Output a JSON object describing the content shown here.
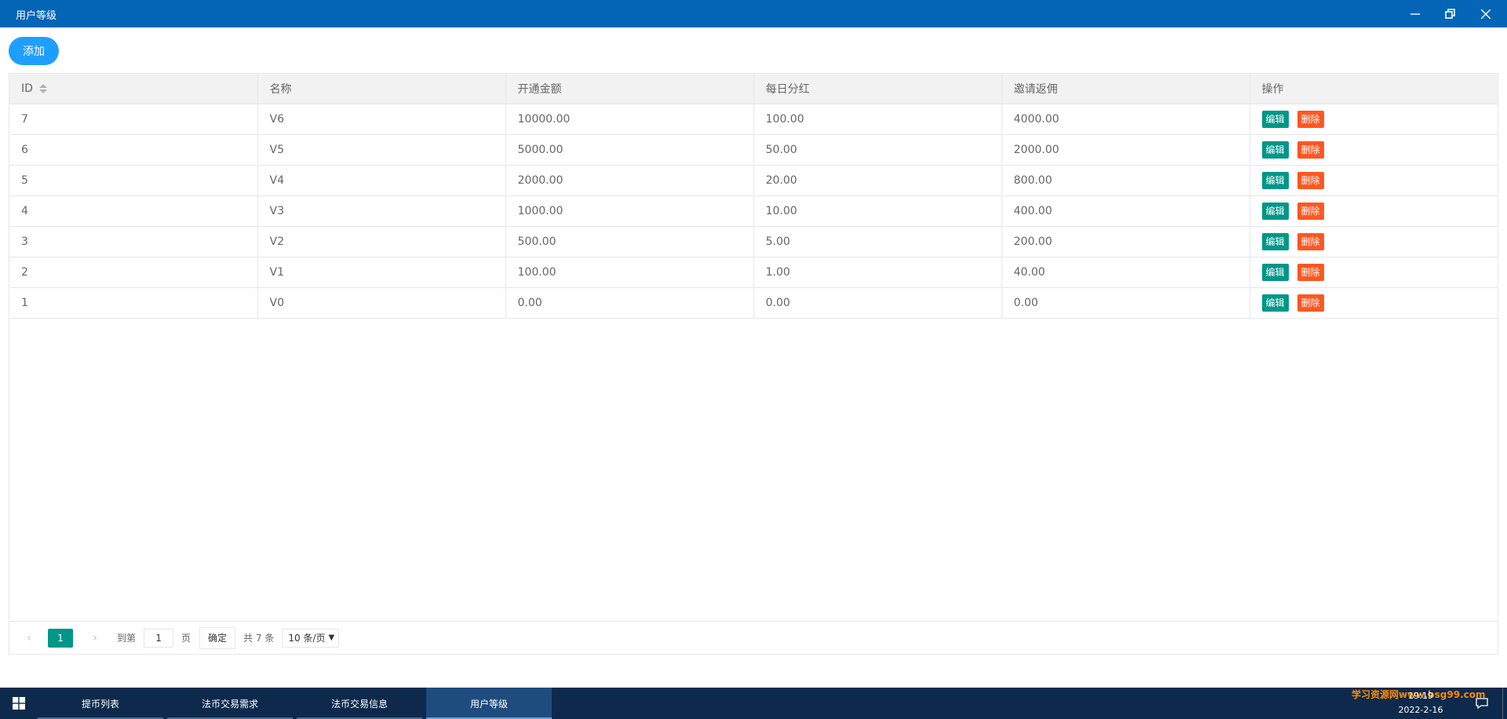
{
  "window": {
    "title": "用户等级"
  },
  "toolbar": {
    "add_label": "添加"
  },
  "table": {
    "headers": [
      "ID",
      "名称",
      "开通金额",
      "每日分红",
      "邀请返佣",
      "操作"
    ],
    "rows": [
      {
        "id": "7",
        "name": "V6",
        "amount": "10000.00",
        "daily": "100.00",
        "commission": "4000.00"
      },
      {
        "id": "6",
        "name": "V5",
        "amount": "5000.00",
        "daily": "50.00",
        "commission": "2000.00"
      },
      {
        "id": "5",
        "name": "V4",
        "amount": "2000.00",
        "daily": "20.00",
        "commission": "800.00"
      },
      {
        "id": "4",
        "name": "V3",
        "amount": "1000.00",
        "daily": "10.00",
        "commission": "400.00"
      },
      {
        "id": "3",
        "name": "V2",
        "amount": "500.00",
        "daily": "5.00",
        "commission": "200.00"
      },
      {
        "id": "2",
        "name": "V1",
        "amount": "100.00",
        "daily": "1.00",
        "commission": "40.00"
      },
      {
        "id": "1",
        "name": "V0",
        "amount": "0.00",
        "daily": "0.00",
        "commission": "0.00"
      }
    ],
    "edit_label": "编辑",
    "delete_label": "删除"
  },
  "pager": {
    "prev": "‹",
    "next": "›",
    "current": "1",
    "goto_label": "到第",
    "goto_value": "1",
    "page_label": "页",
    "confirm_label": "确定",
    "total_label": "共 7 条",
    "limit_value": "10 条/页"
  },
  "taskbar": {
    "tasks": [
      "提币列表",
      "法币交易需求",
      "法币交易信息",
      "用户等级"
    ],
    "active_task": "用户等级",
    "time": "19:19",
    "date": "2022-2-16",
    "watermark": "学习资源网www.bsg99.com"
  },
  "colors": {
    "titlebar": "#0465b6",
    "add_button": "#1E9FFF",
    "edit_button": "#009688",
    "delete_button": "#FF5722",
    "taskbar": "#0d2a4d"
  }
}
